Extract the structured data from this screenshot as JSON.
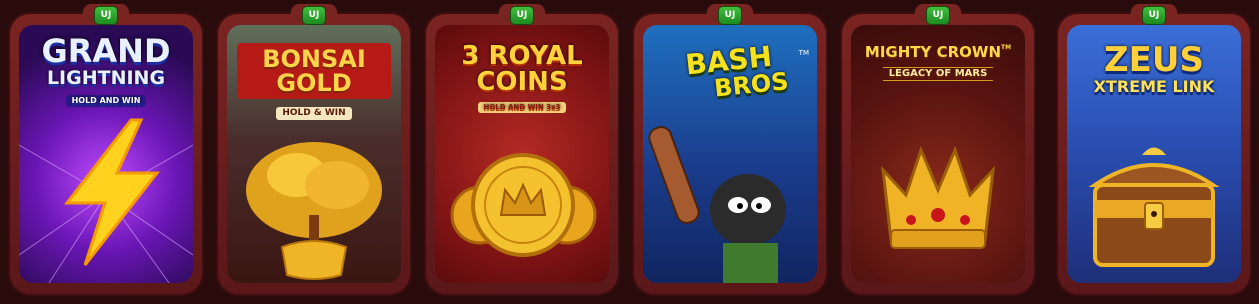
{
  "games": [
    {
      "badge": "UJ",
      "title_lines": [
        "GRAND",
        "LIGHTNING"
      ],
      "subtitle": "HOLD AND WIN"
    },
    {
      "badge": "UJ",
      "title_lines": [
        "BONSAI",
        "GOLD"
      ],
      "subtitle": "HOLD & WIN"
    },
    {
      "badge": "UJ",
      "title_lines": [
        "3 ROYAL",
        "COINS"
      ],
      "subtitle": "HOLD AND WIN 3x3"
    },
    {
      "badge": "UJ",
      "title_lines": [
        "BASH",
        "BROS"
      ],
      "subtitle": "TM"
    },
    {
      "badge": "UJ",
      "title_lines": [
        "MIGHTY CROWN",
        "LEGACY OF MARS"
      ],
      "subtitle": "TM"
    },
    {
      "badge": "UJ",
      "title_lines": [
        "ZEUS",
        "XTREME LINK"
      ],
      "subtitle": ""
    }
  ]
}
